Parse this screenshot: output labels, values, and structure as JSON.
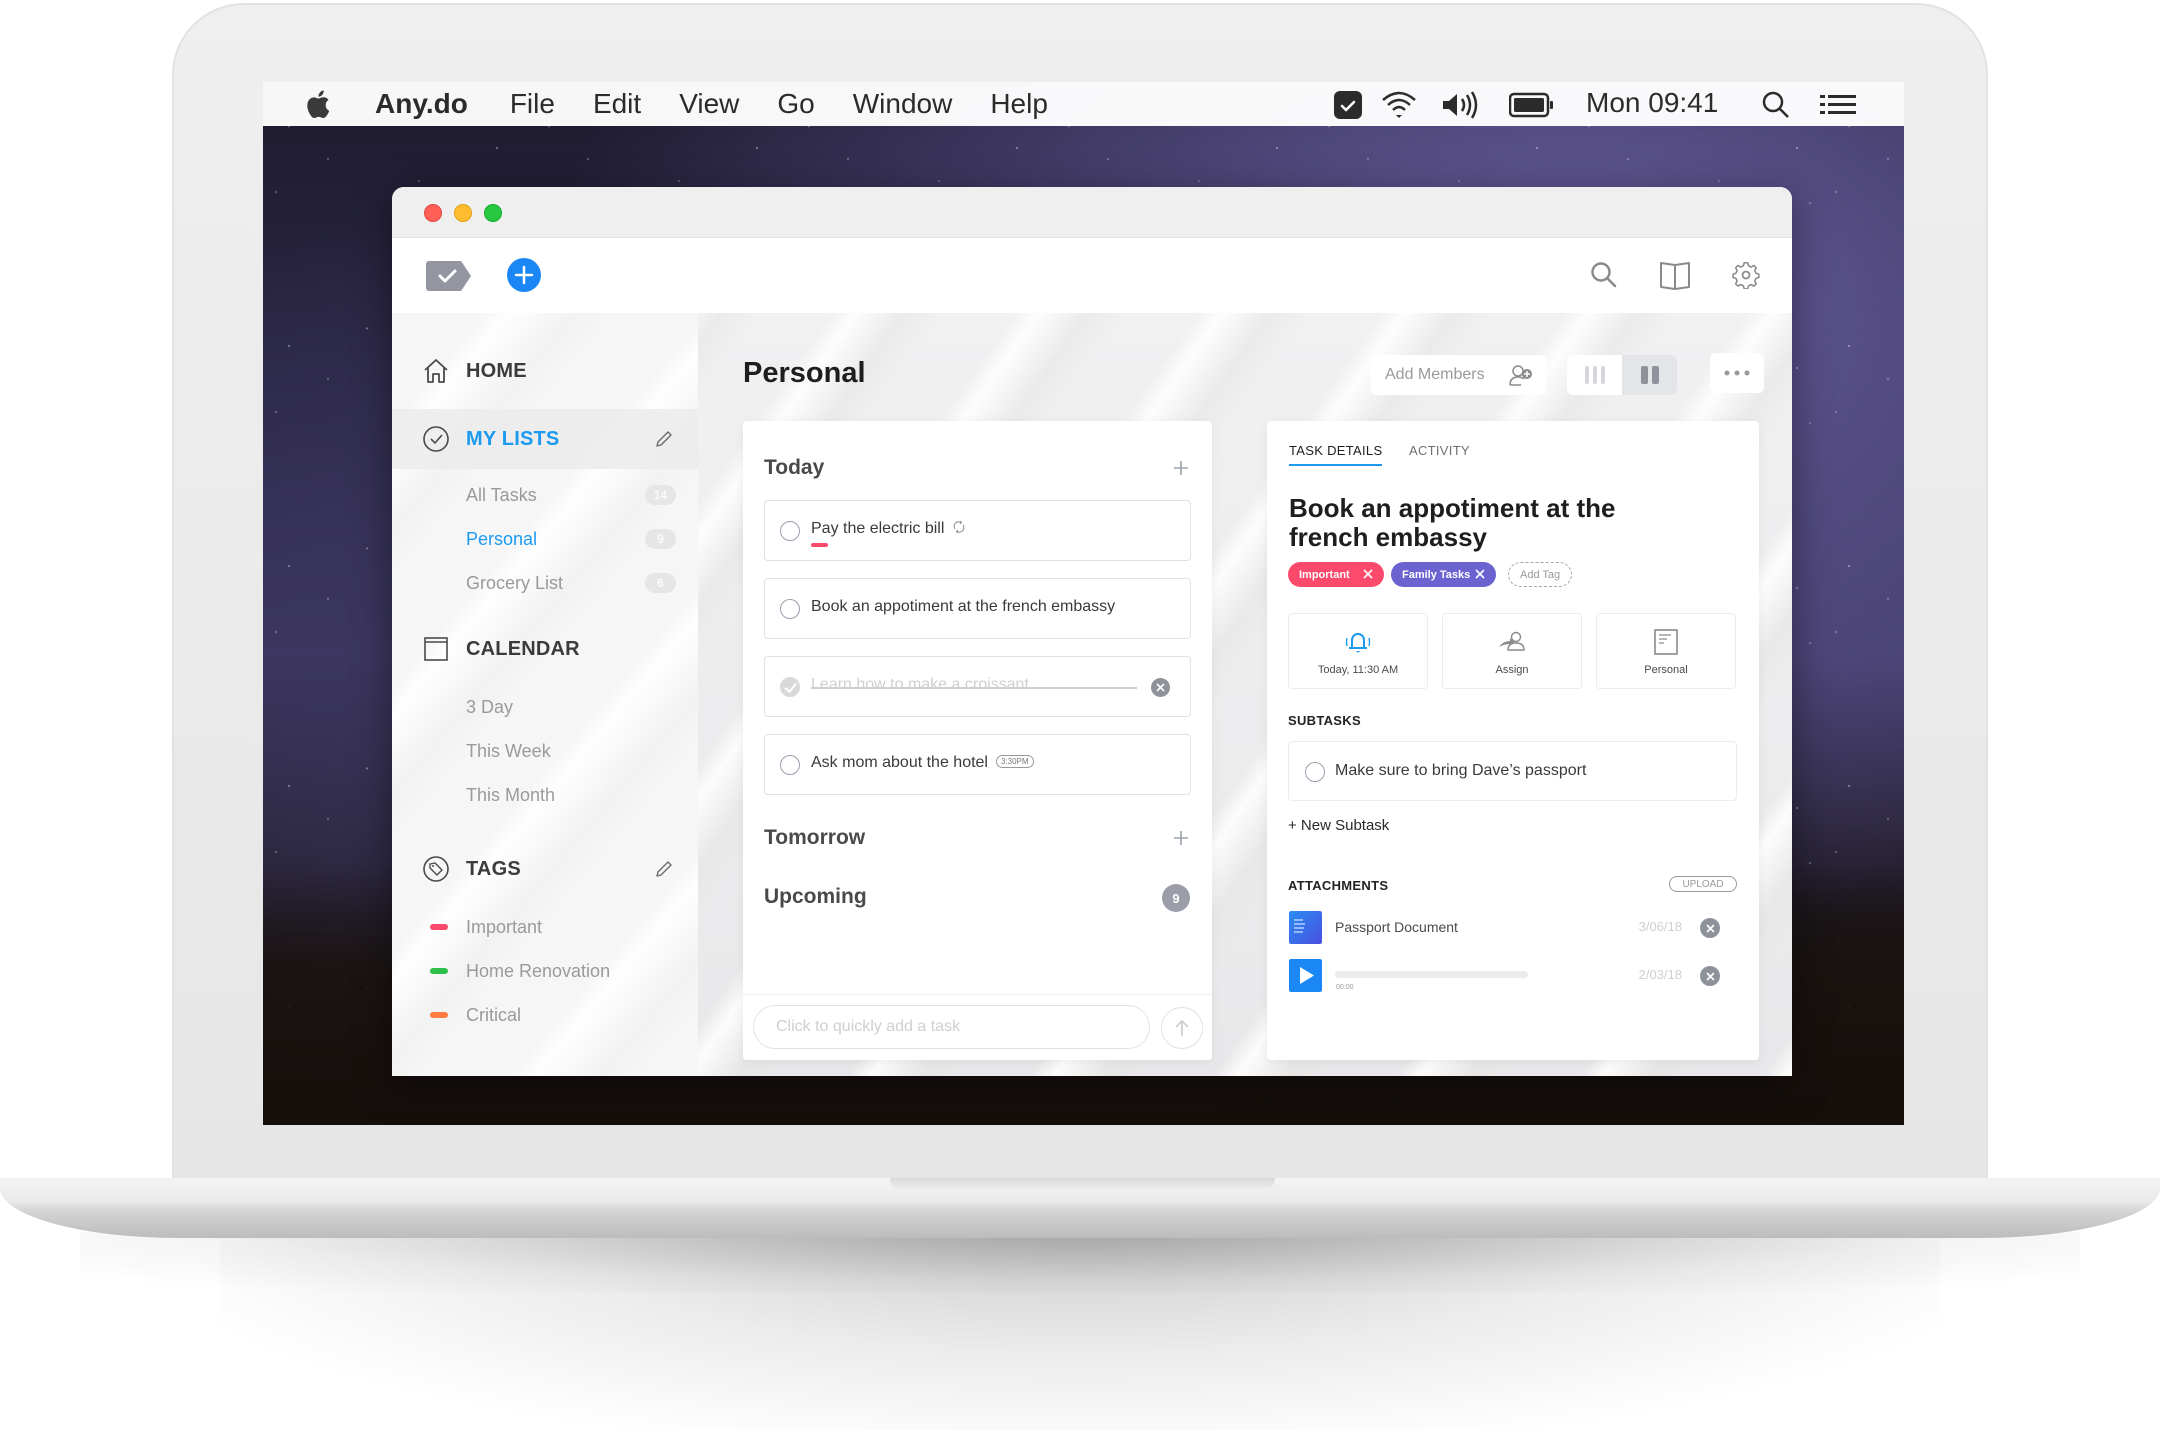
{
  "menubar": {
    "app_name": "Any.do",
    "menus": [
      "File",
      "Edit",
      "View",
      "Go",
      "Window",
      "Help"
    ],
    "clock": "Mon 09:41",
    "status_icons": [
      "anydo-check-icon",
      "wifi-icon",
      "volume-icon",
      "battery-icon",
      "spotlight-search-icon",
      "notification-center-icon"
    ]
  },
  "window": {
    "toolbar_left": [
      "anydo-logo-icon",
      "add-task-icon"
    ],
    "toolbar_right": [
      "search-icon",
      "book-icon",
      "settings-gear-icon",
      "sync-icon"
    ]
  },
  "sidebar": {
    "home_label": "HOME",
    "my_lists": {
      "label": "MY LISTS",
      "items": [
        {
          "label": "All Tasks",
          "count": "14"
        },
        {
          "label": "Personal",
          "count": "9",
          "active": true
        },
        {
          "label": "Grocery List",
          "count": "6"
        }
      ]
    },
    "calendar": {
      "label": "CALENDAR",
      "items": [
        {
          "label": "3 Day"
        },
        {
          "label": "This Week"
        },
        {
          "label": "This Month"
        }
      ]
    },
    "tags": {
      "label": "TAGS",
      "items": [
        {
          "label": "Important",
          "color": "#fb4a6b"
        },
        {
          "label": "Home Renovation",
          "color": "#2cc04a"
        },
        {
          "label": "Critical",
          "color": "#ff7b42"
        }
      ]
    }
  },
  "main": {
    "title": "Personal",
    "add_members_label": "Add Members",
    "view_modes": [
      "columns-view",
      "split-view"
    ],
    "active_view": "split-view",
    "groups": {
      "today": {
        "title": "Today",
        "tasks": [
          {
            "text": "Pay the electric bill",
            "repeat": true,
            "priority_tag": "#fb4a6b",
            "done": false
          },
          {
            "text": "Book an appotiment at the french embassy",
            "done": false
          },
          {
            "text": "Learn how to make a croissant",
            "done": true
          },
          {
            "text": "Ask mom about the hotel",
            "time": "3:30PM",
            "done": false
          }
        ]
      },
      "tomorrow": {
        "title": "Tomorrow"
      },
      "upcoming": {
        "title": "Upcoming",
        "count": "9"
      }
    },
    "quick_add": {
      "placeholder": "Click to quickly add a task"
    }
  },
  "details": {
    "tabs": [
      {
        "label": "TASK DETAILS",
        "active": true
      },
      {
        "label": "ACTIVITY"
      }
    ],
    "title": "Book an appotiment at the french embassy",
    "tags": [
      {
        "label": "Important",
        "color": "#fb4a6b"
      },
      {
        "label": "Family Tasks",
        "color": "#6d63d0"
      }
    ],
    "add_tag_label": "Add Tag",
    "meta": [
      {
        "label": "Today, 11:30 AM",
        "icon": "reminder-bell-icon"
      },
      {
        "label": "Assign",
        "icon": "assign-user-icon"
      },
      {
        "label": "Personal",
        "icon": "list-icon"
      }
    ],
    "subtasks_label": "SUBTASKS",
    "subtasks": [
      {
        "text": "Make sure to bring Dave’s passport"
      }
    ],
    "new_subtask_label": "+ New Subtask",
    "attachments_label": "ATTACHMENTS",
    "upload_label": "UPLOAD",
    "attachments": [
      {
        "type": "document",
        "name": "Passport Document",
        "date": "3/06/18"
      },
      {
        "type": "audio",
        "time": "00:00",
        "progress": 0,
        "date": "2/03/18"
      }
    ]
  }
}
